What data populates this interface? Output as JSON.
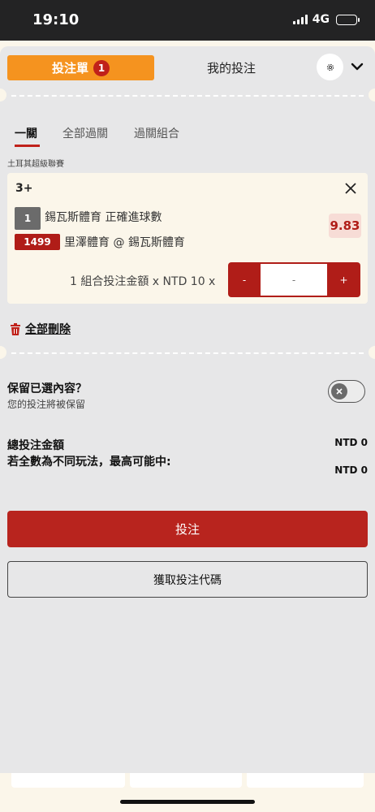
{
  "status_bar": {
    "time": "19:10",
    "network": "4G"
  },
  "header": {
    "betslip_tab": "投注單",
    "betslip_count": "1",
    "mybets_tab": "我的投注"
  },
  "bet_tabs": [
    "一關",
    "全部過關",
    "過關組合"
  ],
  "league": "土耳其超級聯賽",
  "bet": {
    "selection": "3+",
    "leg_number": "1",
    "market": "錫瓦斯體育 正確進球數",
    "event_id": "1499",
    "event": "里澤體育 @ 錫瓦斯體育",
    "odds": "9.83",
    "stake_text": "1 組合投注金額 x NTD 10 x",
    "stepper_minus": "-",
    "stepper_value": "-",
    "stepper_plus": "+"
  },
  "delete_all": "全部刪除",
  "keep": {
    "title": "保留已選內容？",
    "subtitle": "您的投注將被保留"
  },
  "summary": {
    "total_label": "總投注金額",
    "total_value": "NTD 0",
    "max_win_label": "若全數為不同玩法，最高可能中:",
    "max_win_value": "NTD 0"
  },
  "buttons": {
    "place_bet": "投注",
    "get_code": "獲取投注代碼"
  },
  "colors": {
    "brand_red": "#b8241e",
    "tab_orange": "#f5931f",
    "odds_bg": "#f7dcd6"
  }
}
